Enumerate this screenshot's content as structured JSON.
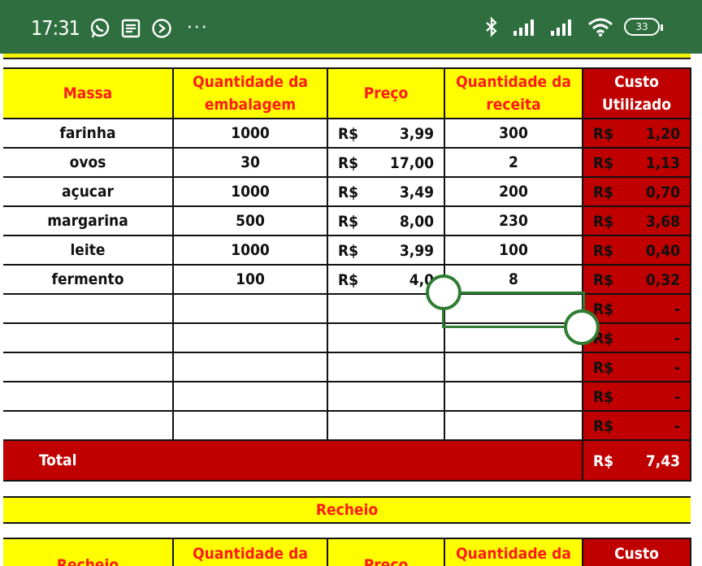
{
  "status_bar": {
    "time": "17:31",
    "battery": "33",
    "icons_left": [
      "whatsapp-icon",
      "notes-icon",
      "app-icon",
      "more-icon"
    ],
    "icons_right": [
      "bluetooth-icon",
      "signal-icon",
      "signal-icon",
      "wifi-icon",
      "battery-icon"
    ],
    "more": "···"
  },
  "colors": {
    "status_bg": "#2f6f3f",
    "header_yellow": "#ffff00",
    "header_text_red": "#ff1a1a",
    "cost_red": "#c00000",
    "selection_green": "#2e7d32"
  },
  "massa_table": {
    "headers": [
      "Massa",
      "Quantidade da embalagem",
      "Preço",
      "Quantidade da receita",
      "Custo Utilizado"
    ],
    "rows": [
      {
        "item": "farinha",
        "qtd_emb": "1000",
        "preco_cur": "R$",
        "preco": "3,99",
        "qtd_rec": "300",
        "custo_cur": "R$",
        "custo": "1,20"
      },
      {
        "item": "ovos",
        "qtd_emb": "30",
        "preco_cur": "R$",
        "preco": "17,00",
        "qtd_rec": "2",
        "custo_cur": "R$",
        "custo": "1,13"
      },
      {
        "item": "açucar",
        "qtd_emb": "1000",
        "preco_cur": "R$",
        "preco": "3,49",
        "qtd_rec": "200",
        "custo_cur": "R$",
        "custo": "0,70"
      },
      {
        "item": "margarina",
        "qtd_emb": "500",
        "preco_cur": "R$",
        "preco": "8,00",
        "qtd_rec": "230",
        "custo_cur": "R$",
        "custo": "3,68"
      },
      {
        "item": "leite",
        "qtd_emb": "1000",
        "preco_cur": "R$",
        "preco": "3,99",
        "qtd_rec": "100",
        "custo_cur": "R$",
        "custo": "0,40"
      },
      {
        "item": "fermento",
        "qtd_emb": "100",
        "preco_cur": "R$",
        "preco": "4,0",
        "qtd_rec": "8",
        "custo_cur": "R$",
        "custo": "0,32"
      },
      {
        "item": "",
        "qtd_emb": "",
        "preco_cur": "",
        "preco": "",
        "qtd_rec": "",
        "custo_cur": "R$",
        "custo": "-"
      },
      {
        "item": "",
        "qtd_emb": "",
        "preco_cur": "",
        "preco": "",
        "qtd_rec": "",
        "custo_cur": "R$",
        "custo": "-"
      },
      {
        "item": "",
        "qtd_emb": "",
        "preco_cur": "",
        "preco": "",
        "qtd_rec": "",
        "custo_cur": "R$",
        "custo": "-"
      },
      {
        "item": "",
        "qtd_emb": "",
        "preco_cur": "",
        "preco": "",
        "qtd_rec": "",
        "custo_cur": "R$",
        "custo": "-"
      },
      {
        "item": "",
        "qtd_emb": "",
        "preco_cur": "",
        "preco": "",
        "qtd_rec": "",
        "custo_cur": "R$",
        "custo": "-"
      }
    ],
    "total": {
      "label": "Total",
      "cur": "R$",
      "value": "7,43"
    }
  },
  "recheio_section": {
    "title": "Recheio",
    "headers": [
      "Recheio",
      "Quantidade da",
      "Preço",
      "Quantidade da",
      "Custo"
    ]
  }
}
